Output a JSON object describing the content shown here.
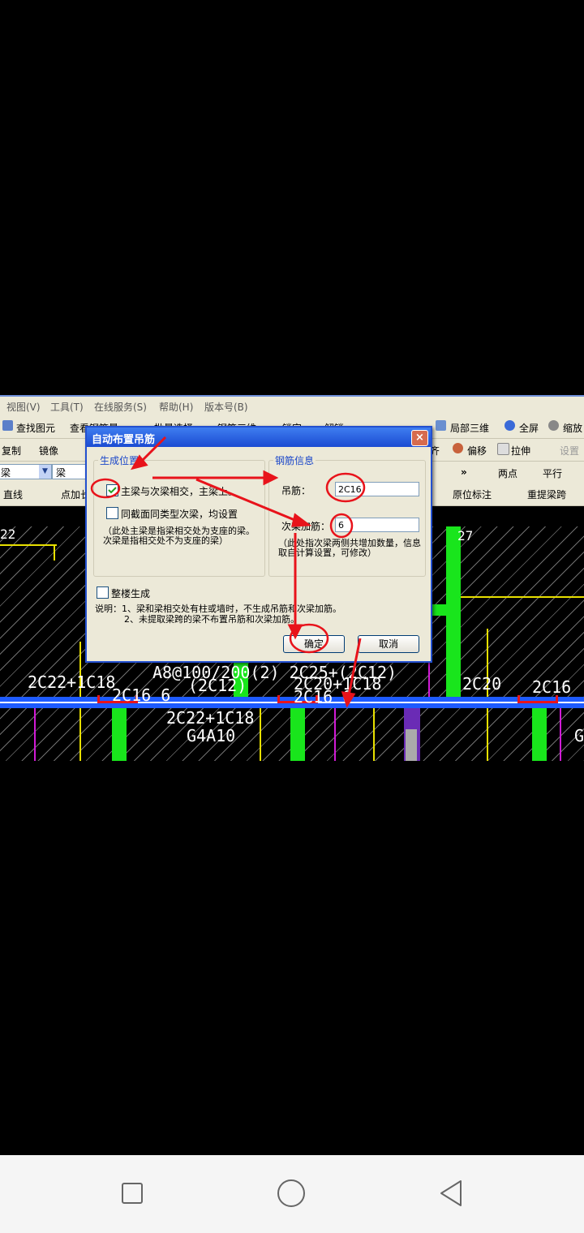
{
  "menu": [
    "视图(V)",
    "工具(T)",
    "在线服务(S)",
    "帮助(H)",
    "版本号(B)"
  ],
  "toolbar1": {
    "find": "查找图元",
    "view_steel": "查看钢筋量",
    "batch_select": "批量选择",
    "steel_3d": "钢筋三维",
    "lock": "锁定",
    "unlock": "解锁",
    "local_3d": "局部三维",
    "fullscreen": "全屏",
    "zoom": "缩放"
  },
  "toolbar2": {
    "copy": "复制",
    "mirror": "镜像",
    "align": "齐",
    "offset": "偏移",
    "stretch": "拉伸",
    "set": "设置"
  },
  "toolbar3": {
    "layer": "梁",
    "type": "梁",
    "two_point": "两点",
    "parallel": "平行"
  },
  "toolbar4": {
    "line": "直线",
    "point_add": "点加长",
    "original_label": "原位标注",
    "re_extract": "重提梁跨"
  },
  "cad": {
    "t1": "2C22+1C18",
    "t2": "2C16 6",
    "t3": "A8@100/200(2) 2C25+(2C12)",
    "t4": "(2C12)",
    "t5": "2C20+1C18",
    "t6": "2C16 6",
    "t7": "2C22+1C18",
    "t8": "G4A10",
    "t9": "2C20",
    "t10": "2C16",
    "t11": "G",
    "t12": "22",
    "t13": "27"
  },
  "dialog": {
    "title": "自动布置吊筋",
    "close": "×",
    "group_position": "生成位置",
    "opt_main_secondary": "主梁与次梁相交，主梁上。",
    "opt_same_section": "同截面同类型次梁，均设置",
    "position_note": "（此处主梁是指梁相交处为支座的梁。次梁是指相交处不为支座的梁）",
    "group_steel": "钢筋信息",
    "hanger_label": "吊筋：",
    "hanger_value": "2C16",
    "secondary_add_label": "次梁加筋：",
    "secondary_add_value": "6",
    "steel_note": "（此处指次梁两侧共增加数量，信息取自计算设置，可修改）",
    "whole_building": "整楼生成",
    "explain_1": "说明：1、梁和梁相交处有柱或墙时，不生成吊筋和次梁加筋。",
    "explain_2": "2、未提取梁跨的梁不布置吊筋和次梁加筋。",
    "ok": "确定",
    "cancel": "取消",
    "main_checked": true
  },
  "colors": {
    "annotation": "#e8131b",
    "beam_blue": "#1e5bff",
    "column_green": "#19e51c",
    "title_blue": "#1b4bd2"
  },
  "nav": {
    "recent": "square-icon",
    "home": "circle-icon",
    "back": "triangle-icon"
  }
}
